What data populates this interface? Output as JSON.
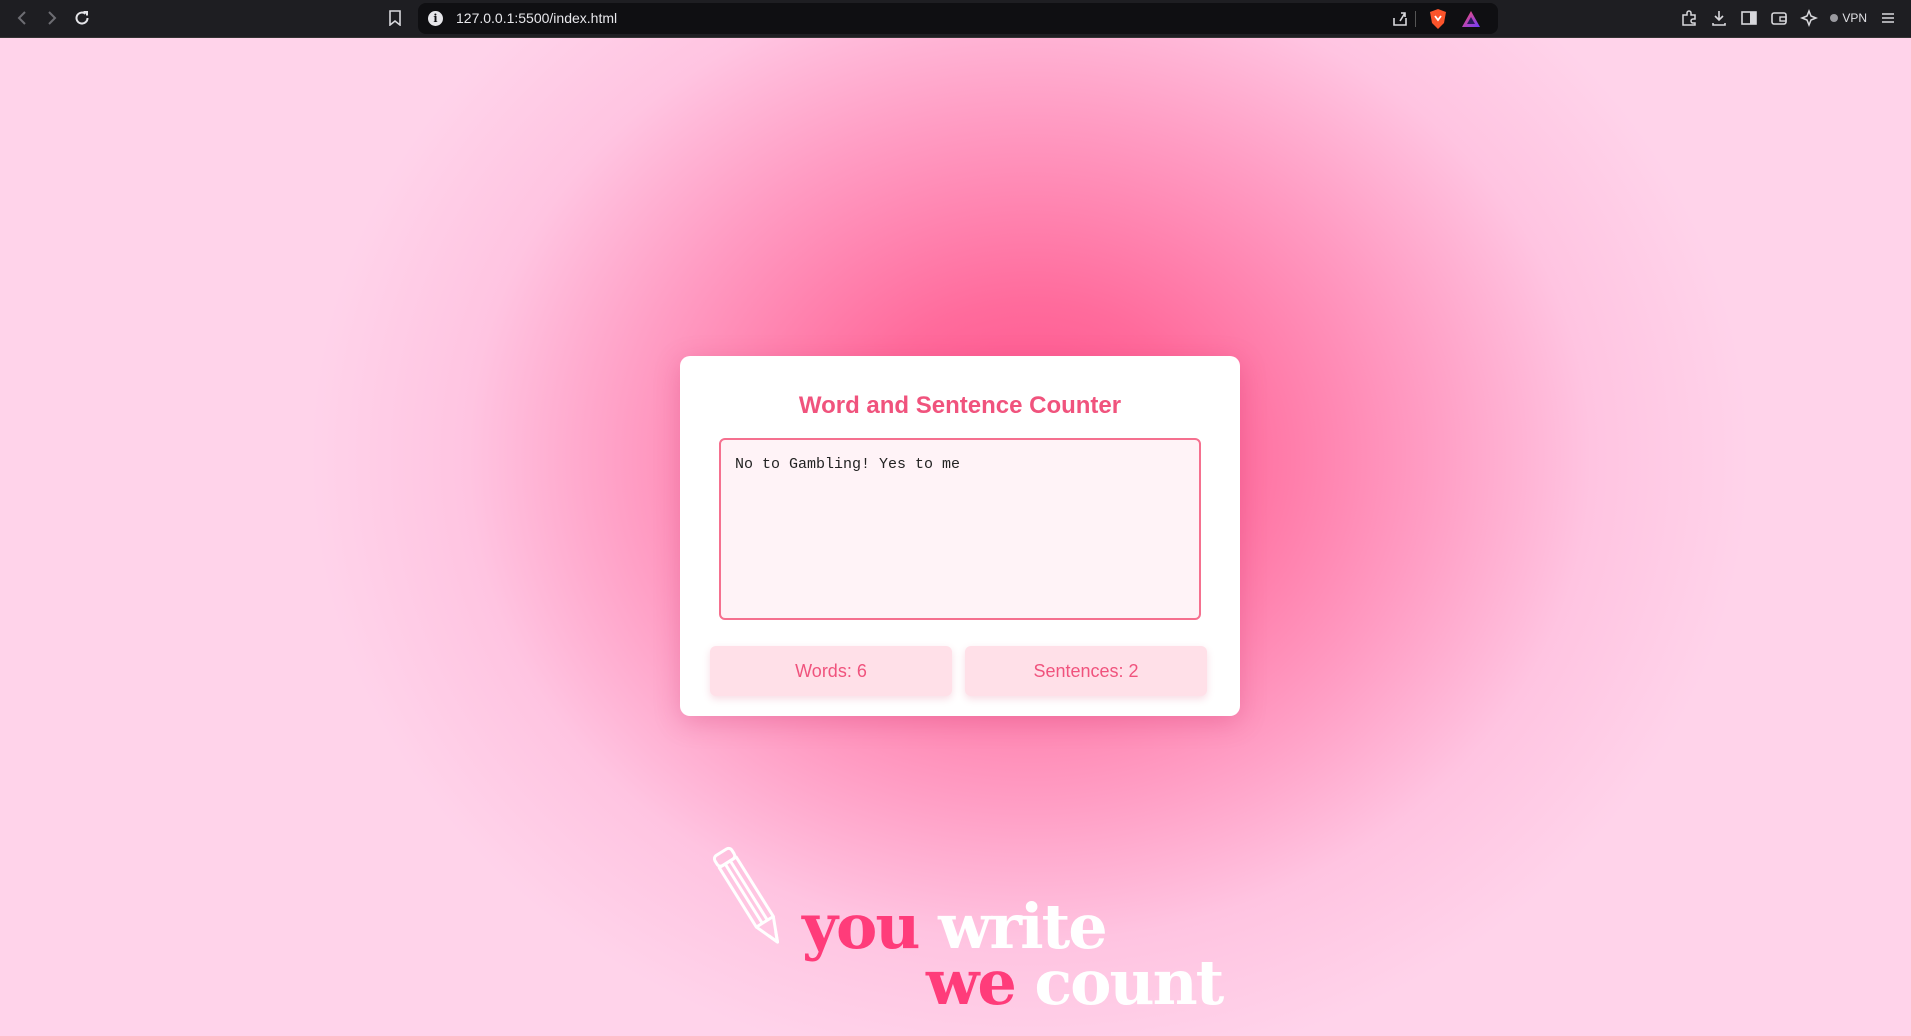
{
  "browser": {
    "url": "127.0.0.1:5500/index.html",
    "vpn_label": "VPN"
  },
  "card": {
    "title": "Word and Sentence Counter",
    "textarea_value": "No to Gambling! Yes to me",
    "words_label": "Words: 6",
    "sentences_label": "Sentences: 2"
  },
  "logo": {
    "word1": "you",
    "word2": "write",
    "word3": "we",
    "word4": "count"
  },
  "colors": {
    "accent": "#f0537d",
    "background": "#ffd3ea",
    "glow": "#ff4f8a"
  }
}
